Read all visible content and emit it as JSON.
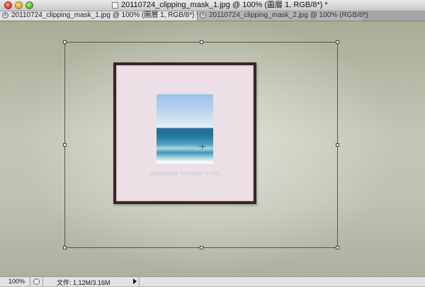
{
  "window": {
    "title": "20110724_clipping_mask_1.jpg @ 100% (圖層 1, RGB/8*) *"
  },
  "tabs": [
    {
      "label": "20110724_clipping_mask_1.jpg @ 100% (圖層 1, RGB/8*) *",
      "active": true
    },
    {
      "label": "20110724_clipping_mask_2.jpg @ 100% (RGB/8*)",
      "active": false
    }
  ],
  "canvas": {
    "caption": "OBSERVER SILENCE ETRE"
  },
  "status": {
    "zoom": "100%",
    "doc_info": "文件: 1.12M/3.16M"
  },
  "icons": {
    "tab_close": "close-icon",
    "status": "status-circle-icon",
    "menu_arrow": "triangle-right-icon"
  }
}
